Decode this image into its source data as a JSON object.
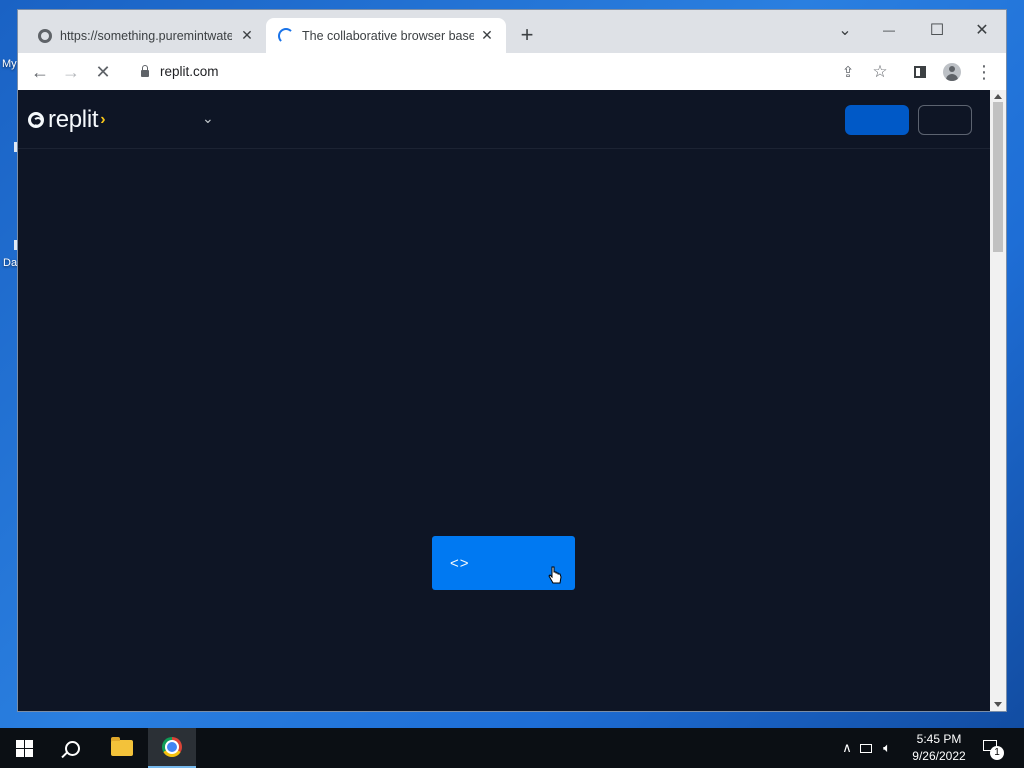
{
  "desktop": {
    "icon_label_1": "My",
    "icon_label_2": "Da"
  },
  "browser": {
    "tabs": [
      {
        "title": "https://something.puremintwater.com",
        "favicon": "globe-icon",
        "state": "inactive"
      },
      {
        "title": "The collaborative browser based IDE - Replit",
        "favicon": "loading-spinner-icon",
        "state": "active"
      }
    ],
    "new_tab_symbol": "+",
    "window_controls": {
      "dropdown": "⌄",
      "minimize": "—",
      "maximize": "☐",
      "close": "✕"
    },
    "toolbar": {
      "back_symbol": "←",
      "forward_symbol": "→",
      "stop_symbol": "✕",
      "url": "replit.com",
      "share_symbol": "⇪",
      "star_symbol": "☆",
      "sidepanel_symbol": "▮",
      "menu_symbol": "⋮"
    }
  },
  "page": {
    "logo_text": "replit",
    "logo_chevron": "›",
    "menu_chevron": "⌄",
    "cta_icon": "<>",
    "colors": {
      "background": "#0e1525",
      "primary_button": "#0059c7",
      "cta": "#0079f2",
      "logo_accent": "#f5c41a"
    }
  },
  "taskbar": {
    "time": "5:45 PM",
    "date": "9/26/2022",
    "notification_count": "1",
    "tray_chevron": "∧"
  }
}
